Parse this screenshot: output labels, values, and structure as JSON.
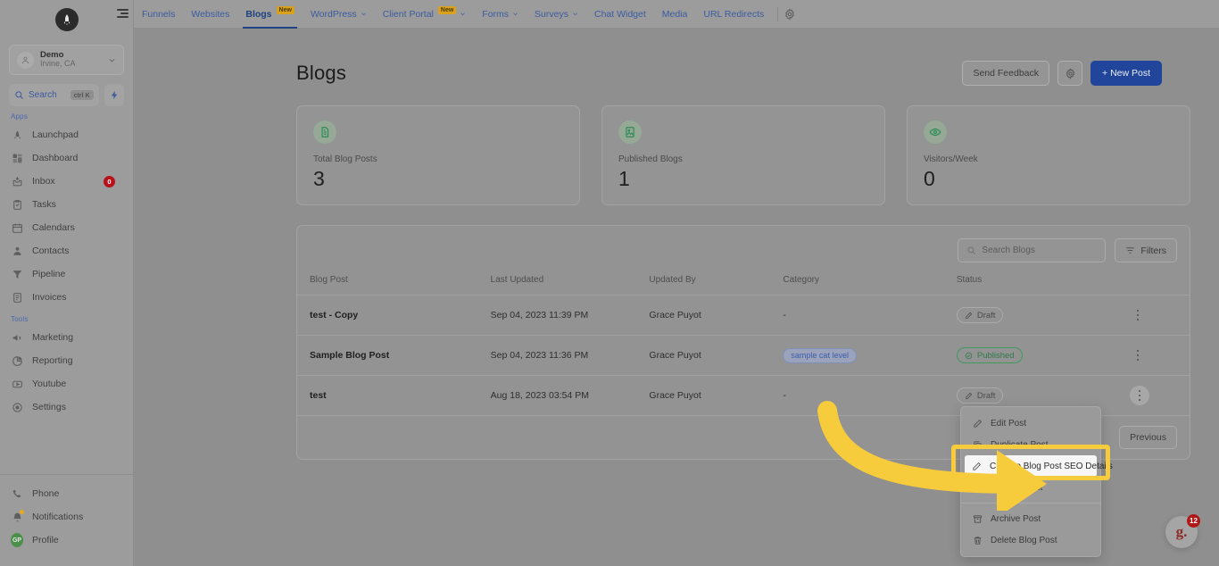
{
  "app": {
    "logo_icon": "rocket-logo-icon",
    "hamburger_icon": "hamburger-menu-icon"
  },
  "sidebar": {
    "account": {
      "name": "Demo",
      "location": "Irvine, CA",
      "avatar_icon": "account-avatar-icon",
      "chevron_icon": "chevron-down-icon"
    },
    "search": {
      "label": "Search",
      "shortcut": "ctrl K",
      "search_icon": "search-icon",
      "bolt_icon": "lightning-bolt-icon"
    },
    "sections": [
      {
        "label": "Apps",
        "items": [
          {
            "label": "Launchpad",
            "icon": "rocket-icon",
            "badge": ""
          },
          {
            "label": "Dashboard",
            "icon": "dashboard-grid-icon",
            "badge": ""
          },
          {
            "label": "Inbox",
            "icon": "inbox-icon",
            "badge": "0"
          },
          {
            "label": "Tasks",
            "icon": "tasks-clipboard-icon",
            "badge": ""
          },
          {
            "label": "Calendars",
            "icon": "calendar-icon",
            "badge": ""
          },
          {
            "label": "Contacts",
            "icon": "contacts-person-icon",
            "badge": ""
          },
          {
            "label": "Pipeline",
            "icon": "pipeline-funnel-icon",
            "badge": ""
          },
          {
            "label": "Invoices",
            "icon": "invoice-document-icon",
            "badge": ""
          }
        ]
      },
      {
        "label": "Tools",
        "items": [
          {
            "label": "Marketing",
            "icon": "megaphone-icon",
            "badge": ""
          },
          {
            "label": "Reporting",
            "icon": "pie-chart-icon",
            "badge": ""
          },
          {
            "label": "Youtube",
            "icon": "youtube-play-icon",
            "badge": ""
          },
          {
            "label": "Settings",
            "icon": "gear-icon",
            "badge": ""
          }
        ]
      }
    ],
    "bottom": [
      {
        "label": "Phone",
        "icon": "phone-icon"
      },
      {
        "label": "Notifications",
        "icon": "bell-icon"
      },
      {
        "label": "Profile",
        "icon": "profile-avatar-icon",
        "initials": "GP"
      }
    ]
  },
  "topnav": {
    "items": [
      {
        "label": "Funnels",
        "tag": "",
        "caret": false,
        "active": false
      },
      {
        "label": "Websites",
        "tag": "",
        "caret": false,
        "active": false
      },
      {
        "label": "Blogs",
        "tag": "New",
        "caret": false,
        "active": true
      },
      {
        "label": "WordPress",
        "tag": "",
        "caret": true,
        "active": false
      },
      {
        "label": "Client Portal",
        "tag": "New",
        "caret": true,
        "active": false
      },
      {
        "label": "Forms",
        "tag": "",
        "caret": true,
        "active": false
      },
      {
        "label": "Surveys",
        "tag": "",
        "caret": true,
        "active": false
      },
      {
        "label": "Chat Widget",
        "tag": "",
        "caret": false,
        "active": false
      },
      {
        "label": "Media",
        "tag": "",
        "caret": false,
        "active": false
      },
      {
        "label": "URL Redirects",
        "tag": "",
        "caret": false,
        "active": false
      }
    ],
    "settings_icon": "gear-icon"
  },
  "page": {
    "title": "Blogs",
    "actions": {
      "send_feedback": "Send Feedback",
      "settings_icon": "gear-icon",
      "new_post": "+ New Post"
    }
  },
  "stats": [
    {
      "label": "Total Blog Posts",
      "value": "3",
      "icon": "document-icon"
    },
    {
      "label": "Published Blogs",
      "value": "1",
      "icon": "image-document-icon"
    },
    {
      "label": "Visitors/Week",
      "value": "0",
      "icon": "eye-icon"
    }
  ],
  "table": {
    "search_placeholder": "Search Blogs",
    "search_icon": "search-icon",
    "filters_label": "Filters",
    "filters_icon": "filter-icon",
    "columns": [
      "Blog Post",
      "Last Updated",
      "Updated By",
      "Category",
      "Status"
    ],
    "rows": [
      {
        "title": "test - Copy",
        "last_updated": "Sep 04, 2023 11:39 PM",
        "updated_by": "Grace Puyot",
        "category": "-",
        "category_is_pill": false,
        "status": "Draft",
        "status_type": "draft"
      },
      {
        "title": "Sample Blog Post",
        "last_updated": "Sep 04, 2023 11:36 PM",
        "updated_by": "Grace Puyot",
        "category": "sample cat level",
        "category_is_pill": true,
        "status": "Published",
        "status_type": "published"
      },
      {
        "title": "test",
        "last_updated": "Aug 18, 2023 03:54 PM",
        "updated_by": "Grace Puyot",
        "category": "-",
        "category_is_pill": false,
        "status": "Draft",
        "status_type": "draft"
      }
    ],
    "pagination": {
      "previous": "Previous"
    }
  },
  "context_menu": {
    "items": [
      {
        "label": "Edit Post",
        "icon": "pencil-icon",
        "highlighted": false
      },
      {
        "label": "Duplicate Post",
        "icon": "copy-icon",
        "highlighted": false
      },
      {
        "label": "Change Blog Post SEO Details",
        "icon": "pencil-icon",
        "highlighted": true
      },
      {
        "label": "Preview Post",
        "icon": "eye-icon",
        "highlighted": false
      },
      {
        "label": "Archive Post",
        "icon": "archive-icon",
        "highlighted": false
      },
      {
        "label": "Delete Blog Post",
        "icon": "trash-icon",
        "highlighted": false
      }
    ]
  },
  "annotation": {
    "arrow_color": "#f6cb3c",
    "highlight_color": "#f6cb3c"
  },
  "help_widget": {
    "glyph": "g.",
    "count": "12"
  },
  "colors": {
    "primary": "#20459a",
    "nav_link": "#3b5ba0",
    "published": "#2d7a48",
    "badge_red": "#b7111b",
    "new_tag": "#d9a21a"
  }
}
